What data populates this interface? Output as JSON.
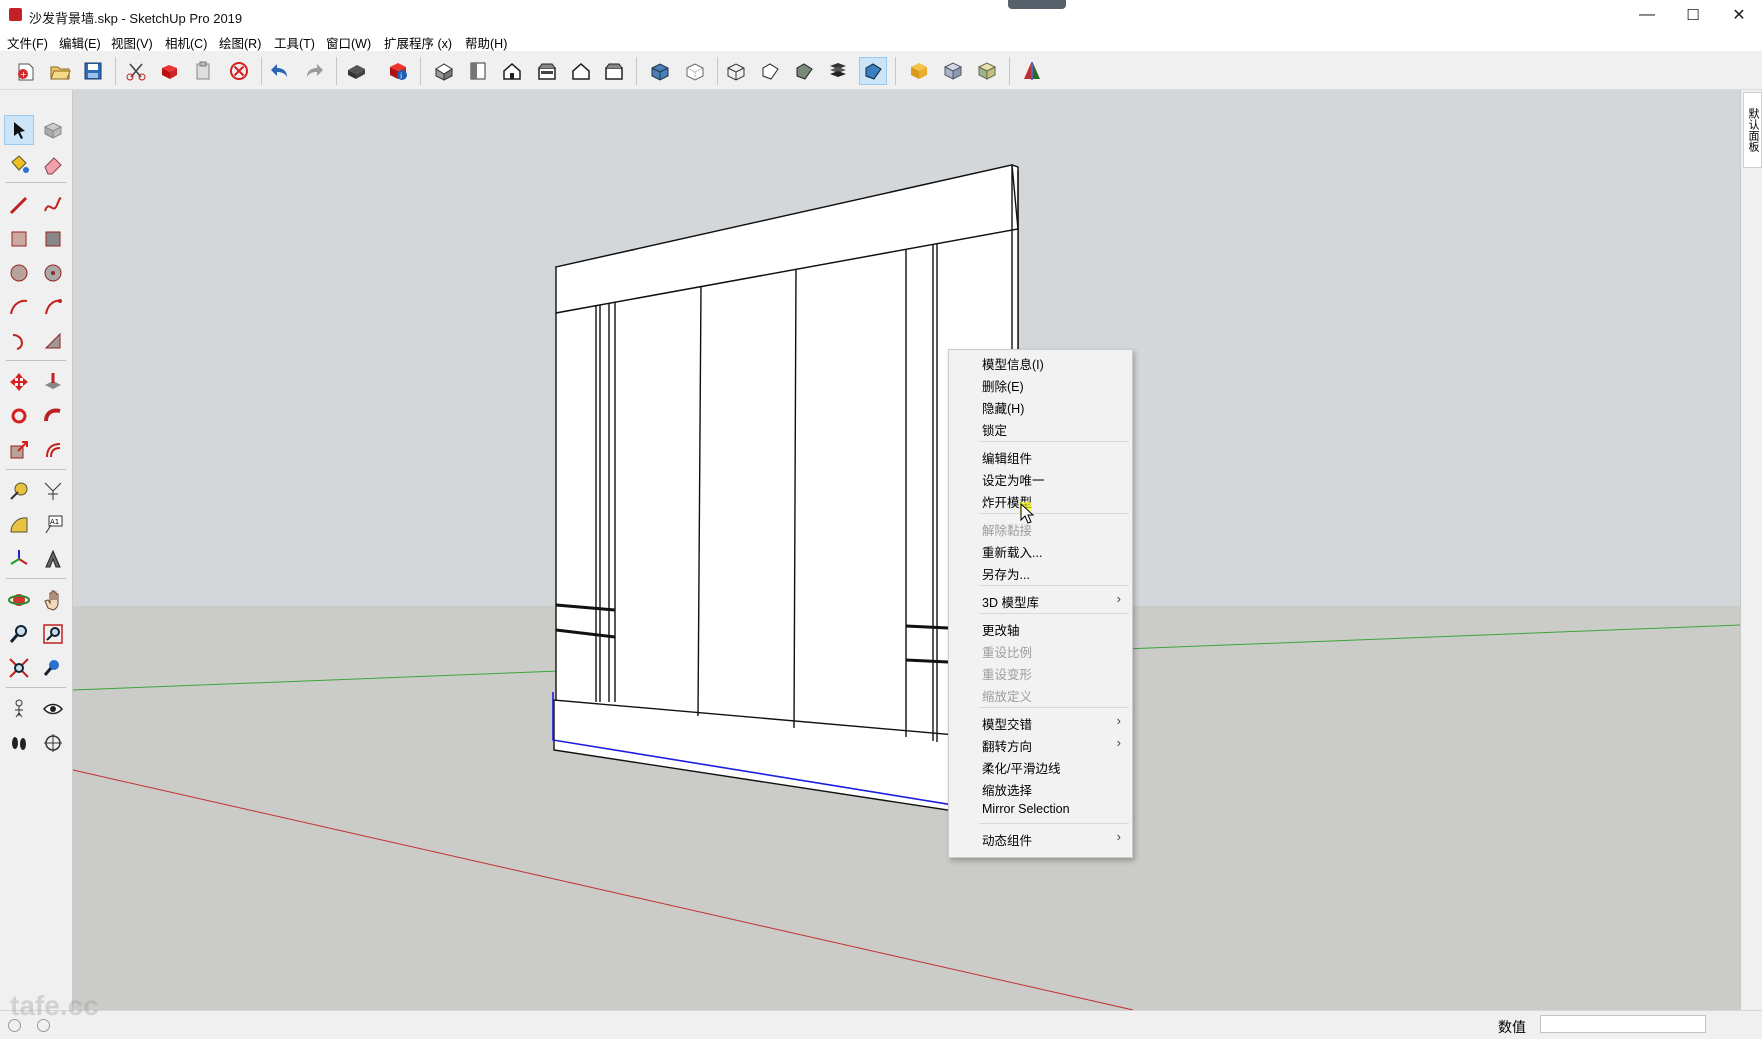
{
  "window": {
    "title": "沙发背景墙.skp - SketchUp Pro 2019",
    "min": "—",
    "max": "☐",
    "close": "✕"
  },
  "menu": [
    "文件(F)",
    "编辑(E)",
    "视图(V)",
    "相机(C)",
    "绘图(R)",
    "工具(T)",
    "窗口(W)",
    "扩展程序 (x)",
    "帮助(H)"
  ],
  "toolbar": {
    "buttons": [
      "new-icon",
      "open-icon",
      "save-icon",
      "cut-icon",
      "copy-icon",
      "paste-icon",
      "erase-icon",
      "undo-icon",
      "redo-icon",
      "print-icon",
      "model-info-icon",
      "iso-view-icon",
      "top-view-icon",
      "front-view-icon",
      "right-view-icon",
      "back-view-icon",
      "left-view-icon",
      "xray-icon",
      "backedge-icon",
      "wireframe-icon",
      "hidden-line-icon",
      "shaded-icon",
      "shaded-texture-icon",
      "monochrome-icon",
      "warehouse-icon",
      "extension-warehouse-icon",
      "layout-icon",
      "section-icon"
    ],
    "active": "monochrome-icon"
  },
  "left_tools": [
    "select-icon",
    "component-icon",
    "paint-bucket-icon",
    "eraser-icon",
    "line-icon",
    "freehand-icon",
    "rectangle-icon",
    "rotated-rectangle-icon",
    "circle-icon",
    "polygon-icon",
    "arc-icon",
    "two-point-arc-icon",
    "three-point-arc-icon",
    "pie-icon",
    "move-icon",
    "push-pull-icon",
    "rotate-icon",
    "follow-me-icon",
    "scale-icon",
    "offset-icon",
    "tape-measure-icon",
    "dimension-icon",
    "protractor-icon",
    "text-icon",
    "axes-icon",
    "3d-text-icon",
    "orbit-icon",
    "pan-icon",
    "zoom-icon",
    "zoom-window-icon",
    "zoom-extents-icon",
    "previous-view-icon",
    "position-camera-icon",
    "look-around-icon",
    "walk-icon",
    "section-plane-icon"
  ],
  "tray": {
    "tab": "默认面板"
  },
  "context_menu": [
    {
      "label": "模型信息(I)",
      "disabled": false
    },
    {
      "label": "删除(E)",
      "disabled": false
    },
    {
      "label": "隐藏(H)",
      "disabled": false
    },
    {
      "label": "锁定",
      "disabled": false
    },
    {
      "sep": true
    },
    {
      "label": "编辑组件",
      "disabled": false
    },
    {
      "label": "设定为唯一",
      "disabled": false
    },
    {
      "label": "炸开模型",
      "disabled": false
    },
    {
      "sep": true
    },
    {
      "label": "解除黏接",
      "disabled": true
    },
    {
      "label": "重新载入...",
      "disabled": false
    },
    {
      "label": "另存为...",
      "disabled": false
    },
    {
      "sep": true
    },
    {
      "label": "3D 模型库",
      "disabled": false,
      "submenu": true
    },
    {
      "sep": true
    },
    {
      "label": "更改轴",
      "disabled": false
    },
    {
      "label": "重设比例",
      "disabled": true
    },
    {
      "label": "重设变形",
      "disabled": true
    },
    {
      "label": "缩放定义",
      "disabled": true
    },
    {
      "sep": true
    },
    {
      "label": "模型交错",
      "disabled": false,
      "submenu": true
    },
    {
      "label": "翻转方向",
      "disabled": false,
      "submenu": true
    },
    {
      "label": "柔化/平滑边线",
      "disabled": false
    },
    {
      "label": "缩放选择",
      "disabled": false
    },
    {
      "label": "Mirror Selection",
      "disabled": false
    },
    {
      "sep": true
    },
    {
      "label": "动态组件",
      "disabled": false,
      "submenu": true
    }
  ],
  "status": {
    "vcb_label": "数值",
    "vcb_value": ""
  },
  "watermark": "tafe.cc",
  "colors": {
    "sky": "#d2d6d8",
    "ground": "#c9c9c6",
    "selection": "#1d1de0",
    "axis_green": "#3aa63a",
    "axis_red": "#c03030",
    "cursor_highlight": "#ffff00"
  }
}
